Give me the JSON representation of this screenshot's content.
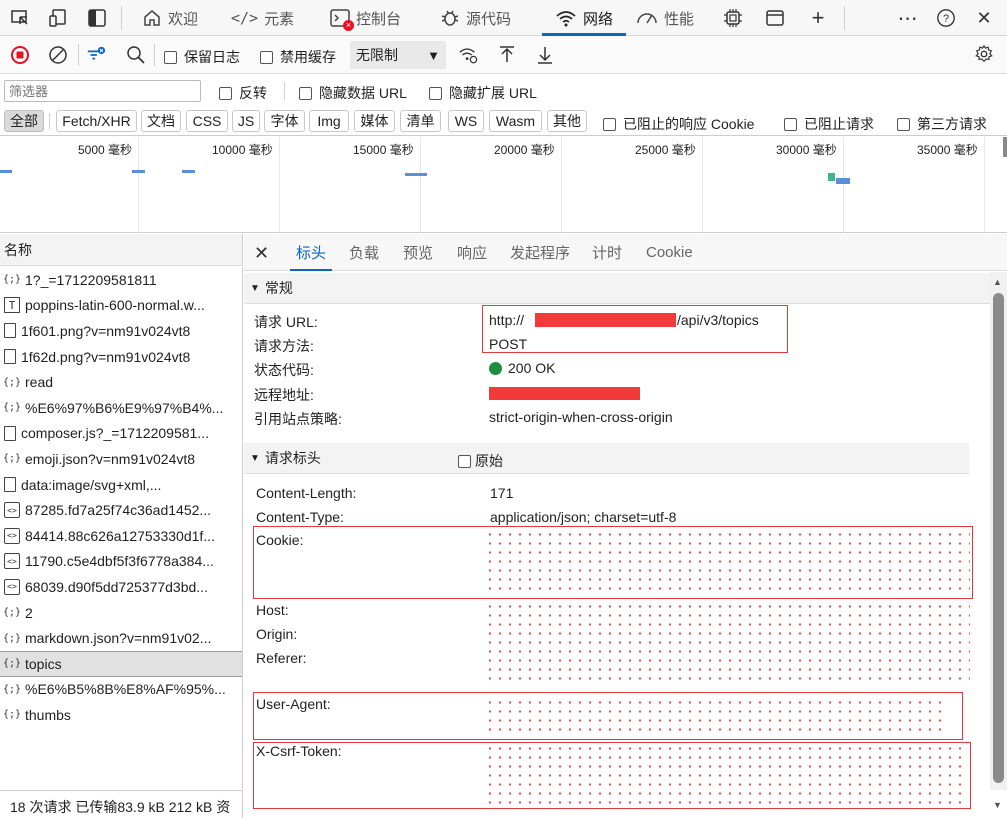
{
  "top_tabs": [
    {
      "label": "欢迎",
      "icon": "home-icon"
    },
    {
      "label": "元素",
      "icon": "code-icon"
    },
    {
      "label": "控制台",
      "icon": "console-icon"
    },
    {
      "label": "源代码",
      "icon": "bug-icon"
    },
    {
      "label": "网络",
      "icon": "wifi-icon"
    },
    {
      "label": "性能",
      "icon": "gauge-icon"
    }
  ],
  "toolbar": {
    "preserve_log": "保留日志",
    "disable_cache": "禁用缓存",
    "throttle": "无限制"
  },
  "filter": {
    "placeholder": "筛选器",
    "invert": "反转",
    "hide_data_url": "隐藏数据 URL",
    "hide_ext_url": "隐藏扩展 URL"
  },
  "types": [
    "全部",
    "Fetch/XHR",
    "文档",
    "CSS",
    "JS",
    "字体",
    "Img",
    "媒体",
    "清单",
    "WS",
    "Wasm",
    "其他"
  ],
  "type_checks": {
    "blocked_cookie": "已阻止的响应 Cookie",
    "blocked_req": "已阻止请求",
    "third_party": "第三方请求"
  },
  "timeline_labels": [
    "5000  毫秒",
    "10000  毫秒",
    "15000  毫秒",
    "20000  毫秒",
    "25000  毫秒",
    "30000  毫秒",
    "35000  毫秒"
  ],
  "list_header": "名称",
  "requests": [
    {
      "name": "1?_=1712209581811",
      "icon": "{;}"
    },
    {
      "name": "poppins-latin-600-normal.w...",
      "icon": "T"
    },
    {
      "name": "1f601.png?v=nm91v024vt8",
      "icon": "doc"
    },
    {
      "name": "1f62d.png?v=nm91v024vt8",
      "icon": "doc"
    },
    {
      "name": "read",
      "icon": "{;}"
    },
    {
      "name": "%E6%97%B6%E9%97%B4%...",
      "icon": "{;}"
    },
    {
      "name": "composer.js?_=1712209581...",
      "icon": "doc"
    },
    {
      "name": "emoji.json?v=nm91v024vt8",
      "icon": "{;}"
    },
    {
      "name": "data:image/svg+xml,...",
      "icon": "doc"
    },
    {
      "name": "87285.fd7a25f74c36ad1452...",
      "icon": "<>"
    },
    {
      "name": "84414.88c626a12753330d1f...",
      "icon": "<>"
    },
    {
      "name": "11790.c5e4dbf5f3f6778a384...",
      "icon": "<>"
    },
    {
      "name": "68039.d90f5dd725377d3bd...",
      "icon": "<>"
    },
    {
      "name": "2",
      "icon": "{;}"
    },
    {
      "name": "markdown.json?v=nm91v02...",
      "icon": "{;}"
    },
    {
      "name": "topics",
      "icon": "{;}"
    },
    {
      "name": "%E6%B5%8B%E8%AF%95%...",
      "icon": "{;}"
    },
    {
      "name": "thumbs",
      "icon": "{;}"
    }
  ],
  "status": "18 次请求  已传输83.9 kB  212 kB 资",
  "detail_tabs": [
    "标头",
    "负载",
    "预览",
    "响应",
    "发起程序",
    "计时",
    "Cookie"
  ],
  "general": {
    "title": "常规",
    "rows": [
      {
        "key": "请求 URL:",
        "value_prefix": "http://",
        "value_suffix": "/api/v3/topics"
      },
      {
        "key": "请求方法:",
        "value": "POST"
      },
      {
        "key": "状态代码:",
        "value": "200 OK"
      },
      {
        "key": "远程地址:",
        "value": ""
      },
      {
        "key": "引用站点策略:",
        "value": "strict-origin-when-cross-origin"
      }
    ]
  },
  "req_headers": {
    "title": "请求标头",
    "raw": "原始",
    "rows": [
      {
        "key": "Content-Length:",
        "value": "171"
      },
      {
        "key": "Content-Type:",
        "value": "application/json; charset=utf-8"
      },
      {
        "key": "Cookie:",
        "value": ""
      },
      {
        "key": "Host:",
        "value": ""
      },
      {
        "key": "Origin:",
        "value": ""
      },
      {
        "key": "Referer:",
        "value": ""
      },
      {
        "key": "User-Agent:",
        "value": ""
      },
      {
        "key": "X-Csrf-Token:",
        "value": ""
      }
    ]
  },
  "colors": {
    "accent": "#0a66c2",
    "redact": "#f23a3a",
    "ok": "#1e8e3e",
    "record": "#e81123"
  }
}
